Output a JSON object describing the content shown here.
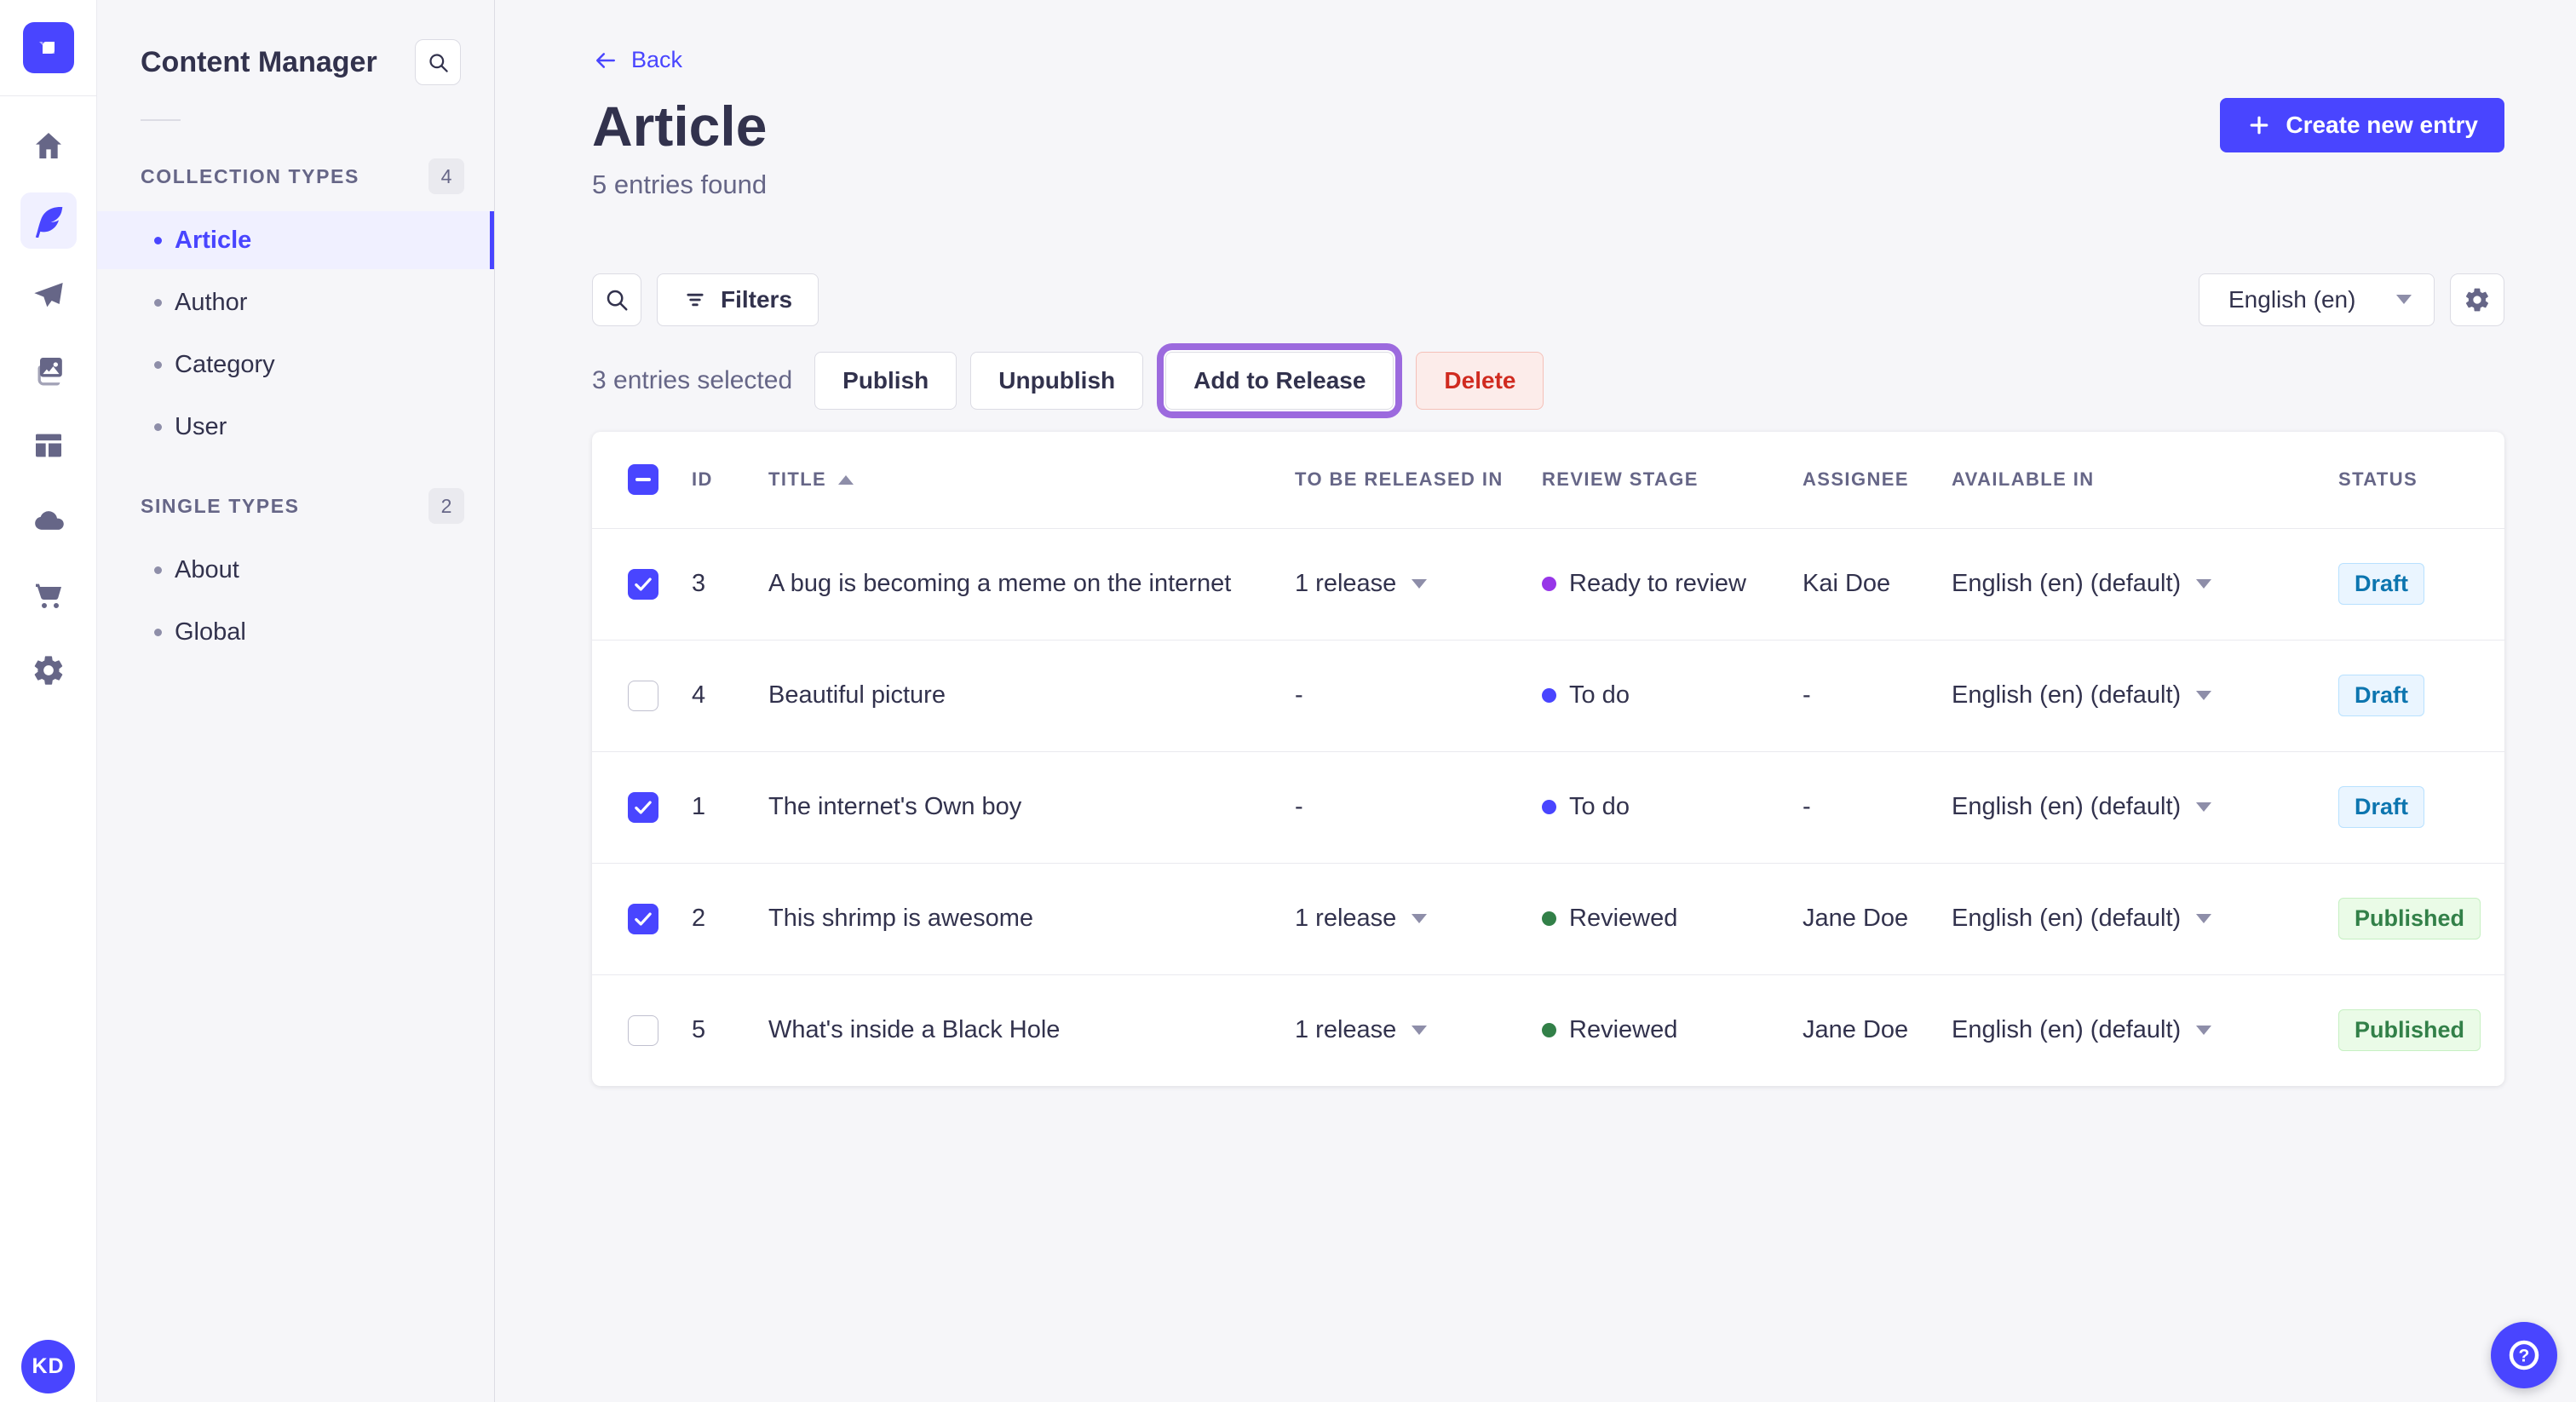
{
  "colors": {
    "primary": "#4945ff",
    "primary_light_bg": "#f0f0ff",
    "draft_badge_text": "#0c75af",
    "published_badge_text": "#328048",
    "delete_text": "#d02b20",
    "release_focus_ring": "#9c6ade"
  },
  "rail": {
    "logo_icon": "strapi-logo",
    "icons": [
      {
        "name": "home-icon",
        "active": false
      },
      {
        "name": "content-manager-feather-icon",
        "active": true
      },
      {
        "name": "paper-plane-icon",
        "active": false
      },
      {
        "name": "media-library-icon",
        "active": false
      },
      {
        "name": "content-type-builder-icon",
        "active": false
      },
      {
        "name": "cloud-icon",
        "active": false
      },
      {
        "name": "marketplace-cart-icon",
        "active": false
      },
      {
        "name": "settings-gear-icon",
        "active": false
      }
    ],
    "avatar_initials": "KD"
  },
  "subnav": {
    "title": "Content Manager",
    "search_icon": "search-icon",
    "sections": [
      {
        "label": "COLLECTION TYPES",
        "count": "4",
        "items": [
          {
            "label": "Article",
            "active": true
          },
          {
            "label": "Author",
            "active": false
          },
          {
            "label": "Category",
            "active": false
          },
          {
            "label": "User",
            "active": false
          }
        ]
      },
      {
        "label": "SINGLE TYPES",
        "count": "2",
        "items": [
          {
            "label": "About",
            "active": false
          },
          {
            "label": "Global",
            "active": false
          }
        ]
      }
    ]
  },
  "header": {
    "back_label": "Back",
    "title": "Article",
    "subtitle": "5 entries found",
    "create_button_label": "Create new entry"
  },
  "toolbar": {
    "search_icon": "search-icon",
    "filters_label": "Filters",
    "locale_value": "English (en)",
    "settings_icon": "gear-icon"
  },
  "selection": {
    "summary": "3 entries selected",
    "publish_label": "Publish",
    "unpublish_label": "Unpublish",
    "add_to_release_label": "Add to Release",
    "delete_label": "Delete"
  },
  "table": {
    "columns": [
      "ID",
      "TITLE",
      "TO BE RELEASED IN",
      "REVIEW STAGE",
      "ASSIGNEE",
      "AVAILABLE IN",
      "STATUS"
    ],
    "sort_column": "TITLE",
    "sort_direction": "asc",
    "header_checkbox_state": "indeterminate",
    "rows": [
      {
        "checked": true,
        "id": "3",
        "title": "A bug is becoming a meme on the internet",
        "release": "1 release",
        "stage": "Ready to review",
        "stage_color": "#9736e8",
        "assignee": "Kai Doe",
        "locale": "English (en) (default)",
        "status": "Draft"
      },
      {
        "checked": false,
        "id": "4",
        "title": "Beautiful picture",
        "release": "-",
        "stage": "To do",
        "stage_color": "#4945ff",
        "assignee": "-",
        "locale": "English (en) (default)",
        "status": "Draft"
      },
      {
        "checked": true,
        "id": "1",
        "title": "The internet's Own boy",
        "release": "-",
        "stage": "To do",
        "stage_color": "#4945ff",
        "assignee": "-",
        "locale": "English (en) (default)",
        "status": "Draft"
      },
      {
        "checked": true,
        "id": "2",
        "title": "This shrimp is awesome",
        "release": "1 release",
        "stage": "Reviewed",
        "stage_color": "#328048",
        "assignee": "Jane Doe",
        "locale": "English (en) (default)",
        "status": "Published"
      },
      {
        "checked": false,
        "id": "5",
        "title": "What's inside a Black Hole",
        "release": "1 release",
        "stage": "Reviewed",
        "stage_color": "#328048",
        "assignee": "Jane Doe",
        "locale": "English (en) (default)",
        "status": "Published"
      }
    ]
  },
  "help": {
    "icon": "question-mark-circle-icon"
  }
}
